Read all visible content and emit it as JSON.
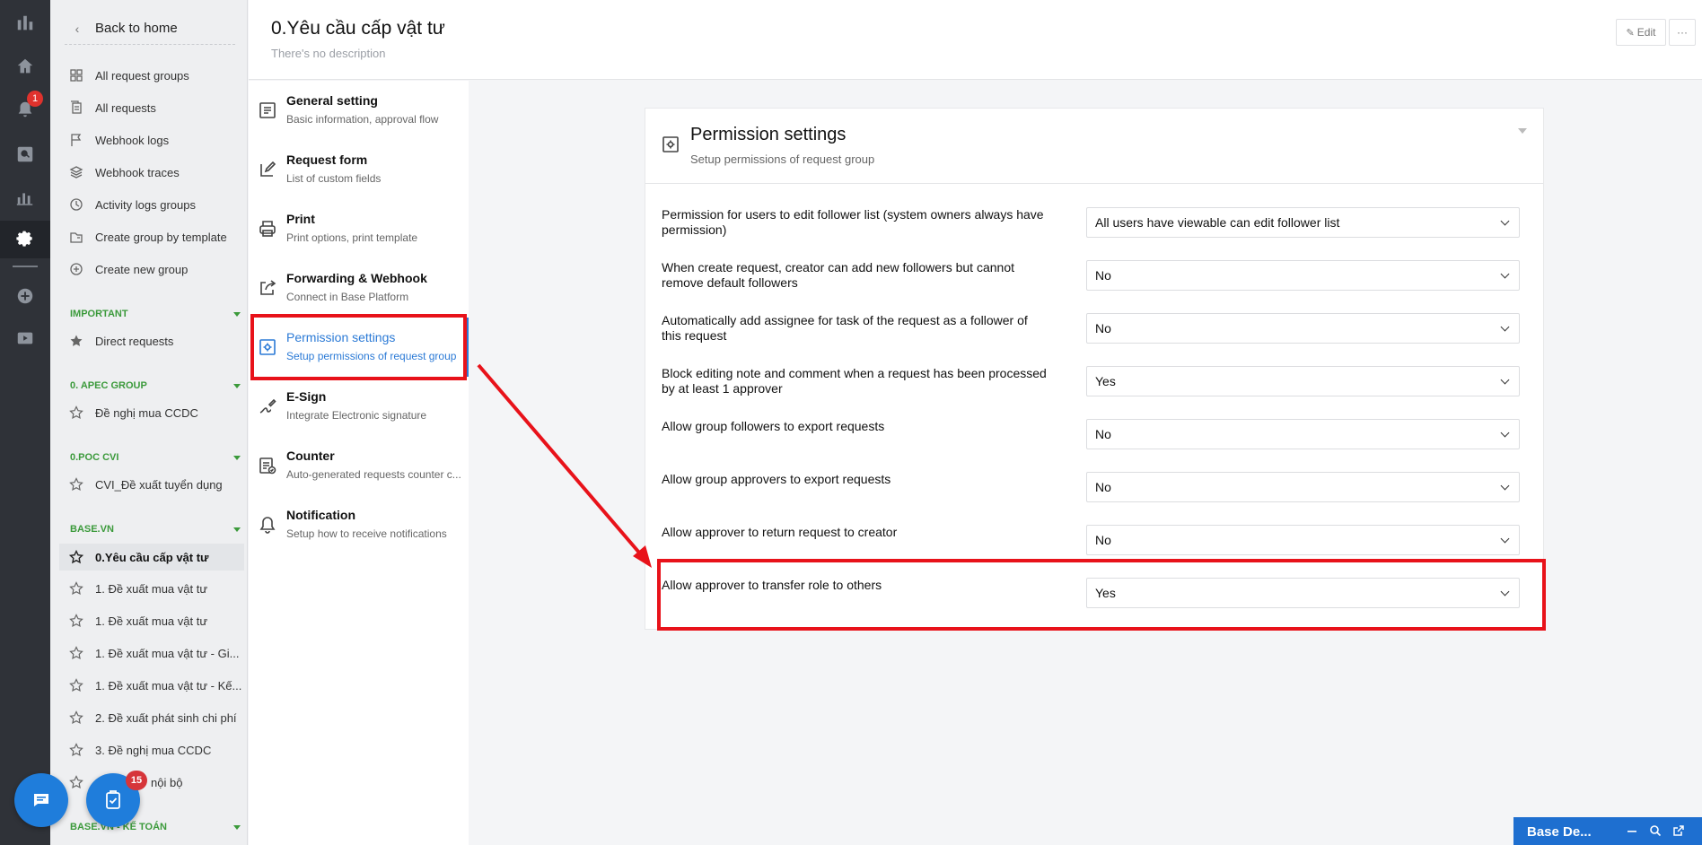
{
  "rail": {
    "notification_count": "1",
    "icons": [
      "logo-icon",
      "home-icon",
      "bell-icon",
      "search-icon",
      "chart-icon",
      "gear-icon",
      "plus-circle-icon",
      "video-icon"
    ]
  },
  "sidebar": {
    "back_label": "Back to home",
    "nav": [
      {
        "label": "All request groups",
        "icon": "grid-icon"
      },
      {
        "label": "All requests",
        "icon": "documents-icon"
      },
      {
        "label": "Webhook logs",
        "icon": "flag-icon"
      },
      {
        "label": "Webhook traces",
        "icon": "layers-icon"
      },
      {
        "label": "Activity logs groups",
        "icon": "clock-icon"
      },
      {
        "label": "Create group by template",
        "icon": "template-icon"
      },
      {
        "label": "Create new group",
        "icon": "plus-circle-icon"
      }
    ],
    "groups": [
      {
        "heading": "IMPORTANT",
        "items": [
          "Direct requests"
        ]
      },
      {
        "heading": "0. APEC GROUP",
        "items": [
          "Đề nghị mua CCDC"
        ]
      },
      {
        "heading": "0.POC CVI",
        "items": [
          "CVI_Đề xuất tuyển dụng"
        ]
      },
      {
        "heading": "BASE.VN",
        "items": [
          "0.Yêu cầu cấp vật tư",
          "1. Đề xuất mua vật tư",
          "1. Đề xuất mua vật tư",
          "1. Đề xuất mua vật tư - Gi...",
          "1. Đề xuất mua vật tư - Kế...",
          "2. Đề xuất phát sinh chi phí",
          "3. Đề nghị mua CCDC",
          "nội bộ"
        ]
      },
      {
        "heading": "BASE.VN - KẾ TOÁN",
        "items": []
      }
    ],
    "fab_badge": "15"
  },
  "header": {
    "title": "0.Yêu cầu cấp vật tư",
    "description": "There's no description",
    "edit_label": "Edit",
    "more_label": "···"
  },
  "settings_menu": [
    {
      "title": "General setting",
      "subtitle": "Basic information, approval flow",
      "icon": "document-icon"
    },
    {
      "title": "Request form",
      "subtitle": "List of custom fields",
      "icon": "edit-icon"
    },
    {
      "title": "Print",
      "subtitle": "Print options, print template",
      "icon": "printer-icon"
    },
    {
      "title": "Forwarding & Webhook",
      "subtitle": "Connect in Base Platform",
      "icon": "share-icon"
    },
    {
      "title": "Permission settings",
      "subtitle": "Setup permissions of request group",
      "icon": "gear-square-icon",
      "active": true
    },
    {
      "title": "E-Sign",
      "subtitle": "Integrate Electronic signature",
      "icon": "signature-icon"
    },
    {
      "title": "Counter",
      "subtitle": "Auto-generated requests counter c...",
      "icon": "counter-icon"
    },
    {
      "title": "Notification",
      "subtitle": "Setup how to receive notifications",
      "icon": "bell-icon"
    }
  ],
  "card": {
    "title": "Permission settings",
    "subtitle": "Setup permissions of request group",
    "rows": [
      {
        "question": "Permission for users to edit follower list (system owners always have permission)",
        "value": "All users have viewable can edit follower list"
      },
      {
        "question": "When create request, creator can add new followers but cannot remove default followers",
        "value": "No"
      },
      {
        "question": "Automatically add assignee for task of the request as a follower of this request",
        "value": "No"
      },
      {
        "question": "Block editing note and comment when a request has been processed by at least 1 approver",
        "value": "Yes"
      },
      {
        "question": "Allow group followers to export requests",
        "value": "No"
      },
      {
        "question": "Allow group approvers to export requests",
        "value": "No"
      },
      {
        "question": "Allow approver to return request to creator",
        "value": "No"
      },
      {
        "question": "Allow approver to transfer role to others",
        "value": "Yes"
      }
    ]
  },
  "chat_bar": {
    "title": "Base De...",
    "icons": [
      "minimize-icon",
      "search-icon",
      "external-icon"
    ]
  },
  "colors": {
    "accent": "#2b7ad6",
    "group_heading": "#3b9a3b",
    "annotation": "#e8121a"
  }
}
